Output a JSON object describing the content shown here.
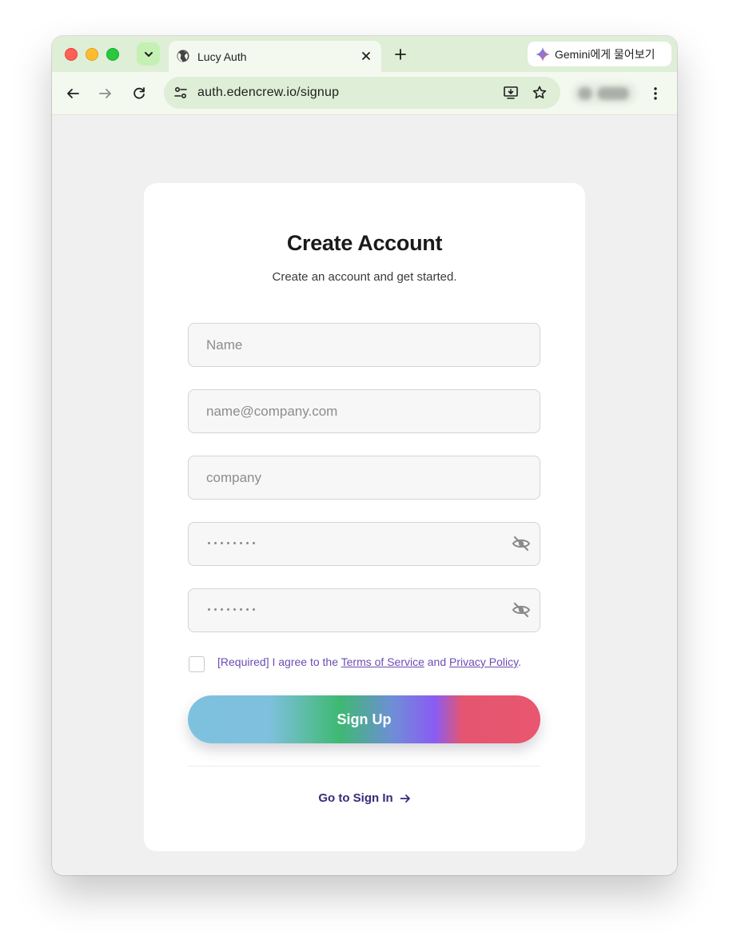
{
  "browser": {
    "tab_title": "Lucy Auth",
    "gemini_label": "Gemini에게 물어보기",
    "url": "auth.edencrew.io/signup"
  },
  "icons": {
    "traffic_close": "red-close-dot",
    "traffic_minimize": "yellow-minimize-dot",
    "traffic_zoom": "green-zoom-dot",
    "tab_search": "chevron-down-icon",
    "tab_favicon": "globe-icon",
    "tab_close": "close-icon",
    "new_tab": "plus-icon",
    "gemini": "sparkle-icon",
    "back": "arrow-left-icon",
    "forward": "arrow-right-icon",
    "reload": "reload-icon",
    "site_info": "tune-icon",
    "install": "install-app-icon",
    "bookmark": "star-icon",
    "menu": "kebab-menu-icon",
    "password_toggle": "eye-off-icon"
  },
  "signup": {
    "title": "Create Account",
    "subtitle": "Create an account and get started.",
    "fields": {
      "name_placeholder": "Name",
      "email_placeholder": "name@company.com",
      "company_placeholder": "company",
      "password_value": "••••••••",
      "confirm_value": "••••••••"
    },
    "agreement": {
      "prefix": "[Required] I agree to the ",
      "terms": "Terms of Service",
      "middle": " and ",
      "privacy": "Privacy Policy",
      "suffix": "."
    },
    "submit_label": "Sign Up",
    "signin_label": "Go to Sign In"
  },
  "colors": {
    "tab_bar": "#dfeed6",
    "toolbar": "#f4f9ef",
    "page_bg": "#f0f0f0",
    "link_purple": "#6b4db3",
    "signin_purple": "#3b2a7a",
    "gradient": [
      "#7ec1df",
      "#3eb972",
      "#8a5cf3",
      "#e6556f"
    ]
  }
}
